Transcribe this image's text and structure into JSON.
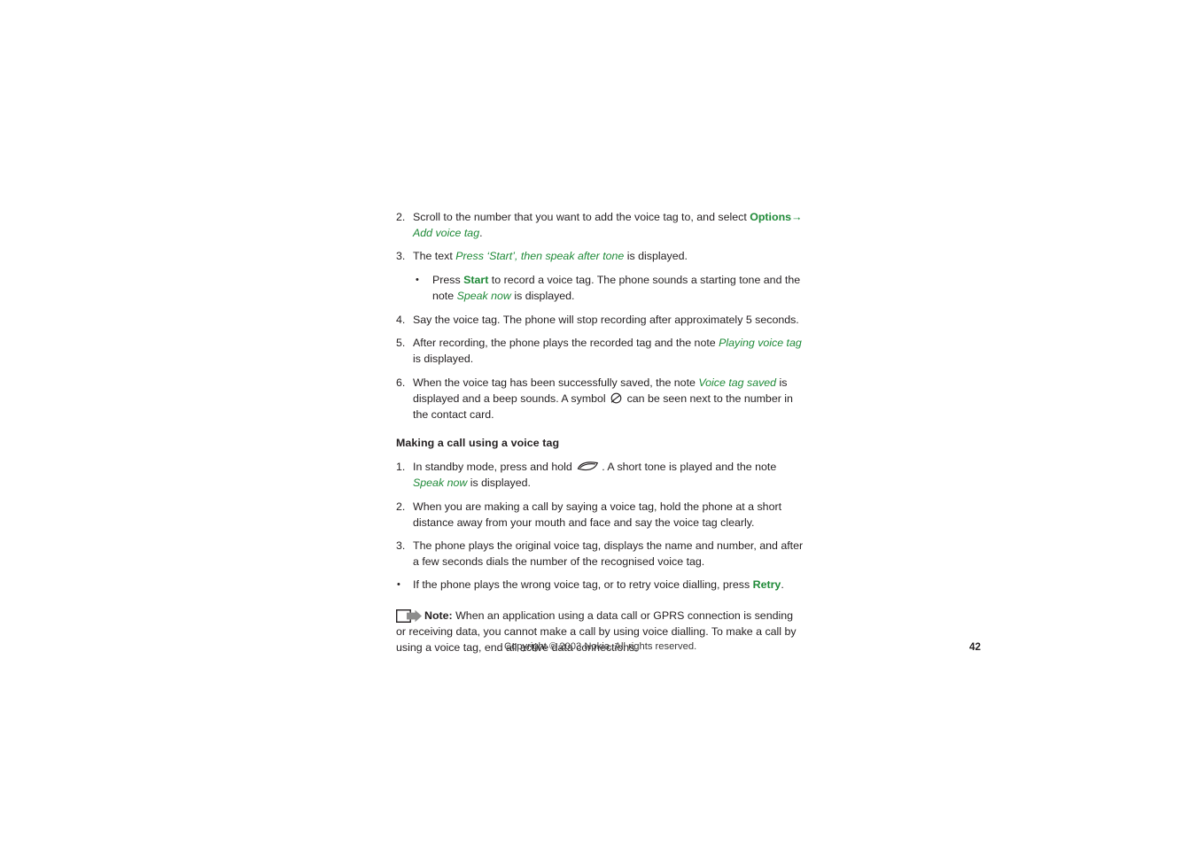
{
  "document": {
    "steps_voice_tag": [
      {
        "marker": "2.",
        "text_parts": [
          {
            "text": "Scroll to the number that you want to add the voice tag to, and select ",
            "style": "plain"
          },
          {
            "text": "Options",
            "style": "green-bold"
          },
          {
            "text": "→ ",
            "style": "green"
          },
          {
            "text": "Add voice tag",
            "style": "green-italic"
          },
          {
            "text": ".",
            "style": "plain"
          }
        ]
      },
      {
        "marker": "3.",
        "text_parts": [
          {
            "text": "The text ",
            "style": "plain"
          },
          {
            "text": "Press ‘Start’, then speak after tone",
            "style": "green-italic"
          },
          {
            "text": " is displayed.",
            "style": "plain"
          }
        ]
      },
      {
        "marker": "•",
        "sub": true,
        "text_parts": [
          {
            "text": "Press ",
            "style": "plain"
          },
          {
            "text": "Start",
            "style": "green-bold"
          },
          {
            "text": " to record a voice tag. The phone sounds a starting tone and the note ",
            "style": "plain"
          },
          {
            "text": "Speak now",
            "style": "green-italic"
          },
          {
            "text": " is displayed.",
            "style": "plain"
          }
        ]
      },
      {
        "marker": "4.",
        "text_parts": [
          {
            "text": "Say the voice tag. The phone will stop recording after approximately 5 seconds.",
            "style": "plain"
          }
        ]
      },
      {
        "marker": "5.",
        "text_parts": [
          {
            "text": "After recording, the phone plays the recorded tag and the note ",
            "style": "plain"
          },
          {
            "text": "Playing voice tag",
            "style": "green-italic"
          },
          {
            "text": " is displayed.",
            "style": "plain"
          }
        ]
      },
      {
        "marker": "6.",
        "text_parts": [
          {
            "text": "When the voice tag has been successfully saved, the note ",
            "style": "plain"
          },
          {
            "text": "Voice tag saved",
            "style": "green-italic"
          },
          {
            "text": " is displayed and a beep sounds. A symbol ",
            "style": "plain"
          },
          {
            "icon": "voice-tag-symbol-icon"
          },
          {
            "text": " can be seen next to the number in the contact card.",
            "style": "plain"
          }
        ]
      }
    ],
    "subheading": "Making a call using a voice tag",
    "steps_making_call": [
      {
        "marker": "1.",
        "text_parts": [
          {
            "text": "In standby mode, press and hold ",
            "style": "plain"
          },
          {
            "icon": "voice-key-icon"
          },
          {
            "text": ". A short tone is played and the note ",
            "style": "plain"
          },
          {
            "text": "Speak now",
            "style": "green-italic"
          },
          {
            "text": " is displayed.",
            "style": "plain"
          }
        ]
      },
      {
        "marker": "2.",
        "text_parts": [
          {
            "text": "When you are making a call by saying a voice tag, hold the phone at a short distance away from your mouth and face and say the voice tag clearly.",
            "style": "plain"
          }
        ]
      },
      {
        "marker": "3.",
        "text_parts": [
          {
            "text": "The phone plays the original voice tag, displays the name and number, and after a few seconds dials the number of the recognised voice tag.",
            "style": "plain"
          }
        ]
      },
      {
        "marker": "•",
        "flush": true,
        "text_parts": [
          {
            "text": "If the phone plays the wrong voice tag, or to retry voice dialling, press ",
            "style": "plain"
          },
          {
            "text": "Retry",
            "style": "green-bold"
          },
          {
            "text": ".",
            "style": "plain"
          }
        ]
      }
    ],
    "note": {
      "label": "Note:",
      "icon": "note-arrow-icon",
      "text": " When an application using a data call or GPRS connection is sending or receiving data, you cannot make a call by using voice dialling. To make a call by using a voice tag, end all active data connections."
    },
    "footer": {
      "copyright": "Copyright © 2003 Nokia. All rights reserved.",
      "page_number": "42"
    },
    "colors": {
      "accent_green": "#1f8a38",
      "body_text": "#231f20",
      "note_arrow_gray": "#8c8c8c"
    }
  }
}
